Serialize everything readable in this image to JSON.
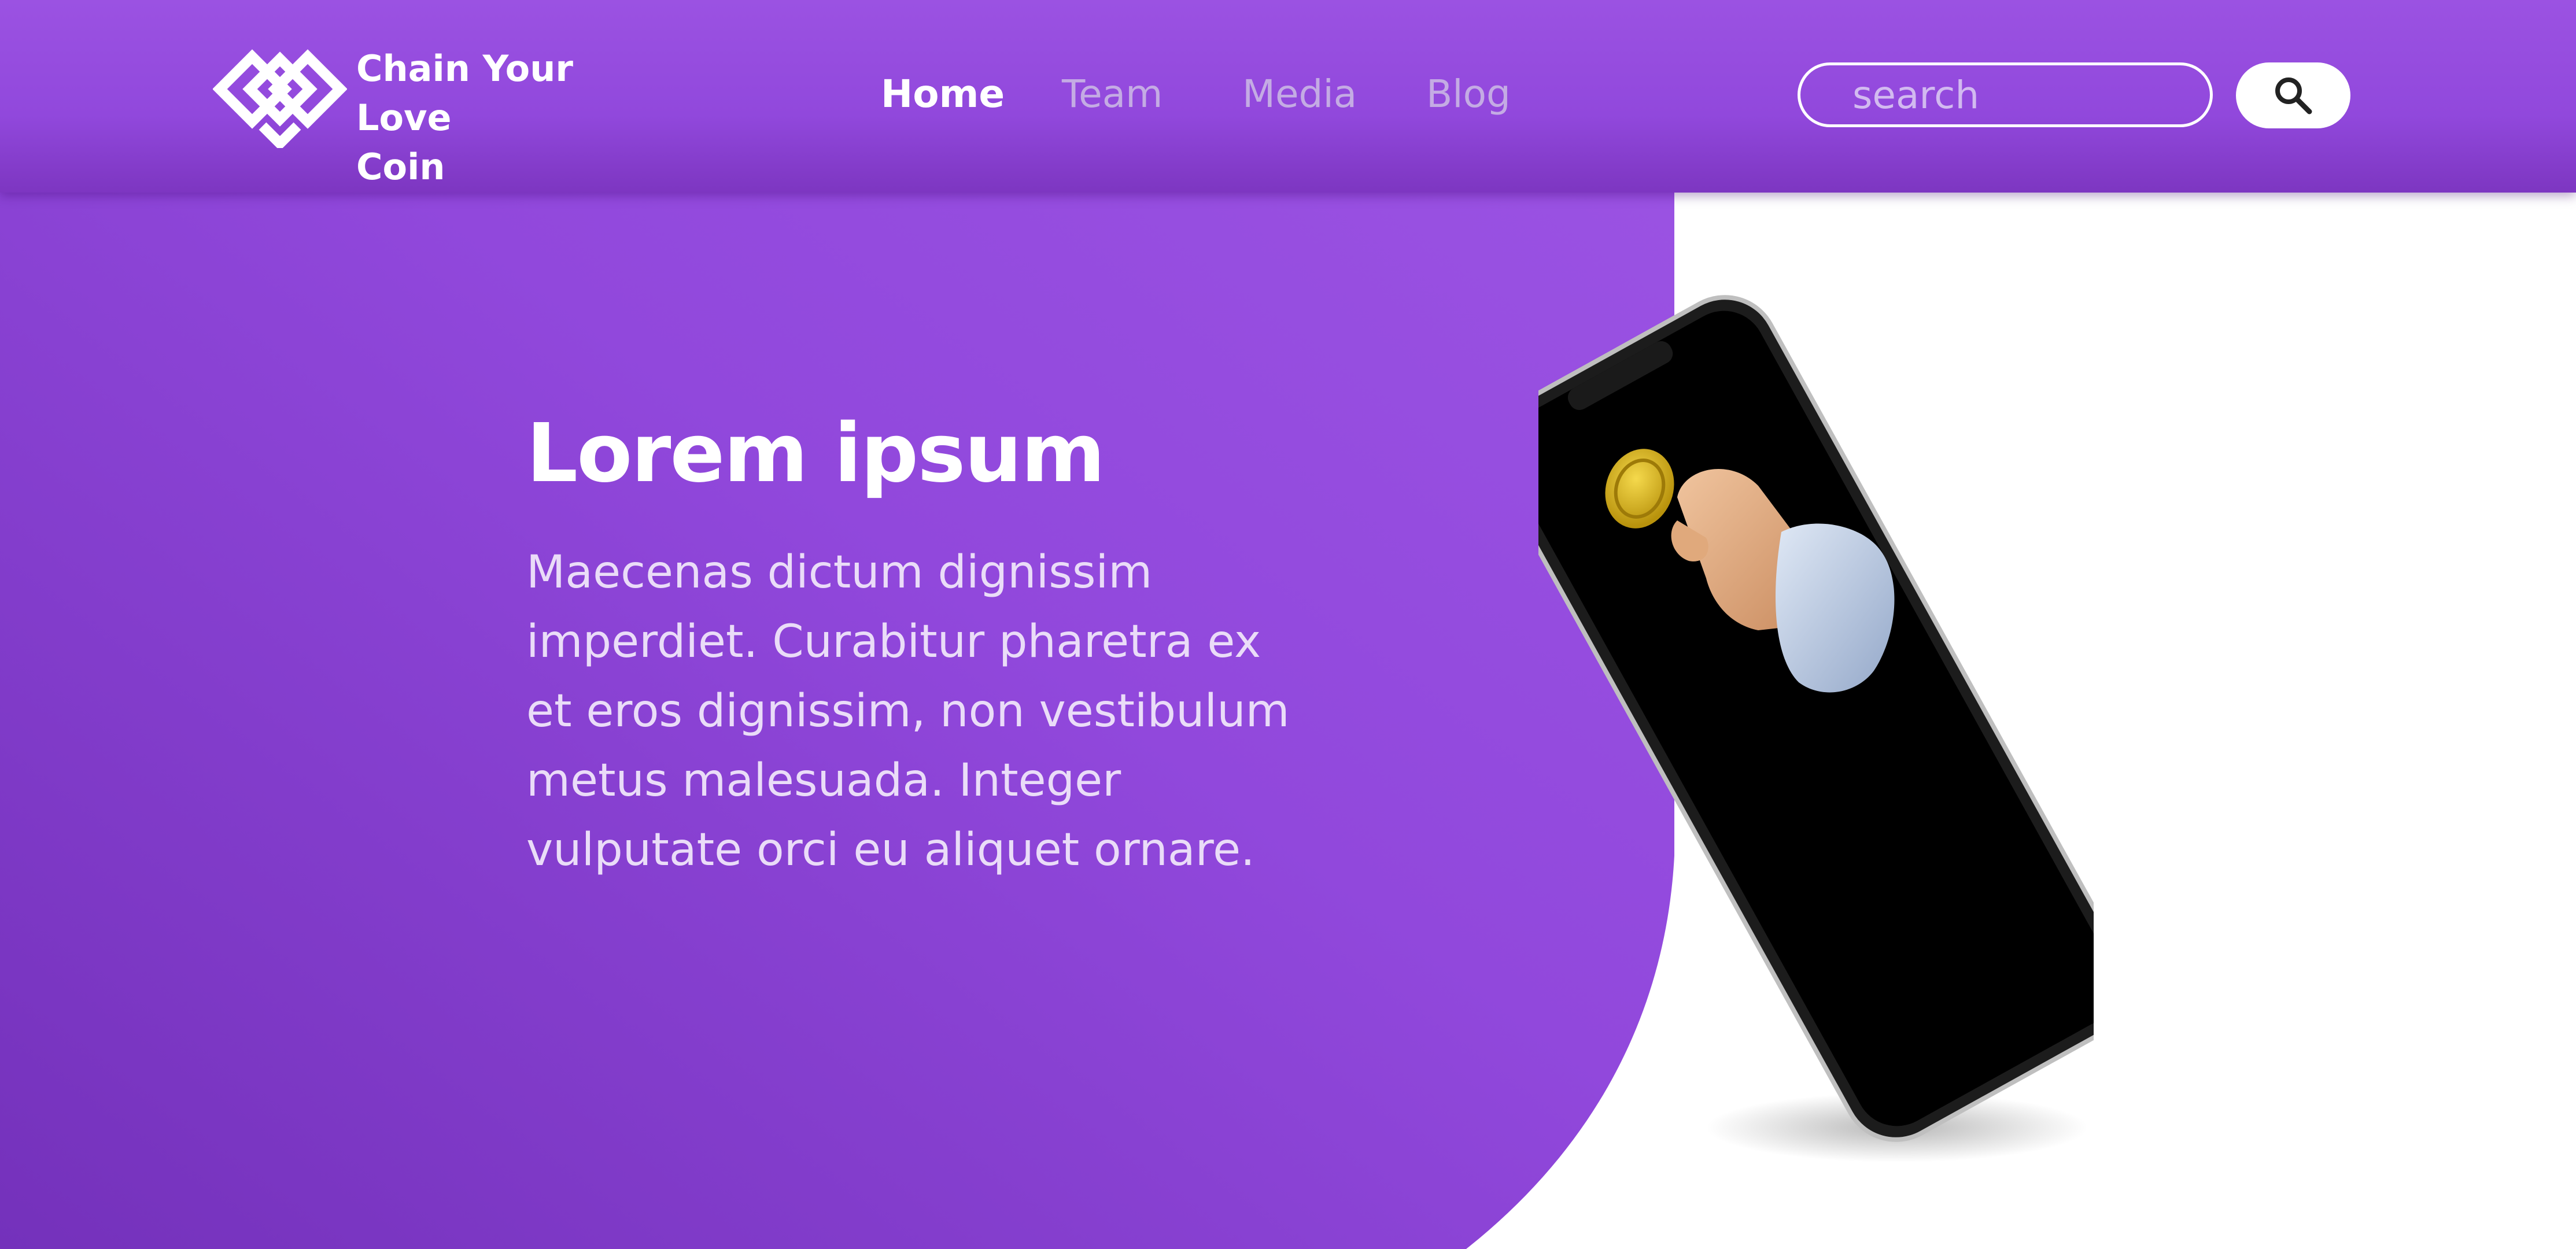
{
  "brand": {
    "name_line1": "Chain Your Love",
    "name_line2": "Coin",
    "logo_icon": "interlocked-hearts-diamond-icon"
  },
  "nav": {
    "items": [
      {
        "label": "Home",
        "active": true
      },
      {
        "label": "Team",
        "active": false
      },
      {
        "label": "Media",
        "active": false
      },
      {
        "label": "Blog",
        "active": false
      }
    ]
  },
  "search": {
    "placeholder": "search",
    "value": "",
    "button_icon": "search-icon"
  },
  "hero": {
    "title": "Lorem ipsum",
    "body": "Maecenas dictum dignissim imperdiet. Curabitur pharetra ex et eros dignissim, non vestibulum metus malesuada. Integer vulputate orci eu aliquet ornare.",
    "image": "smartphone-with-hand-holding-coin-illustration"
  },
  "colors": {
    "primary_purple": "#9b52e2",
    "deep_purple": "#7a34c0",
    "nav_inactive": "#c4abe4",
    "text_white": "#ffffff",
    "coin_gold": "#d9b21f"
  }
}
